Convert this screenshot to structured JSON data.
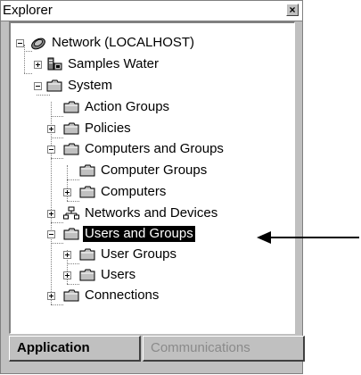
{
  "window": {
    "title": "Explorer",
    "close_label": "×"
  },
  "tree": {
    "items": [
      {
        "label": "Network (LOCALHOST)",
        "icon": "network-icon",
        "expander": "minus"
      },
      {
        "label": "Samples Water",
        "icon": "server-icon",
        "expander": "plus"
      },
      {
        "label": "System",
        "icon": "folder-icon",
        "expander": "minus"
      },
      {
        "label": "Action Groups",
        "icon": "folder-icon",
        "expander": "none"
      },
      {
        "label": "Policies",
        "icon": "folder-icon",
        "expander": "plus"
      },
      {
        "label": "Computers and Groups",
        "icon": "folder-icon",
        "expander": "minus"
      },
      {
        "label": "Computer Groups",
        "icon": "folder-icon",
        "expander": "none"
      },
      {
        "label": "Computers",
        "icon": "folder-icon",
        "expander": "plus"
      },
      {
        "label": "Networks and Devices",
        "icon": "network-devices-icon",
        "expander": "plus"
      },
      {
        "label": "Users and Groups",
        "icon": "folder-icon",
        "expander": "minus",
        "selected": true
      },
      {
        "label": "User Groups",
        "icon": "folder-icon",
        "expander": "plus"
      },
      {
        "label": "Users",
        "icon": "folder-icon",
        "expander": "plus"
      },
      {
        "label": "Connections",
        "icon": "folder-icon",
        "expander": "plus"
      }
    ]
  },
  "tabs": {
    "application": "Application",
    "communications": "Communications"
  },
  "colors": {
    "window_bg": "#c0c0c0",
    "selection_bg": "#000000",
    "folder_fill": "#c0c0c0",
    "disabled_text": "#8a8a8a"
  }
}
